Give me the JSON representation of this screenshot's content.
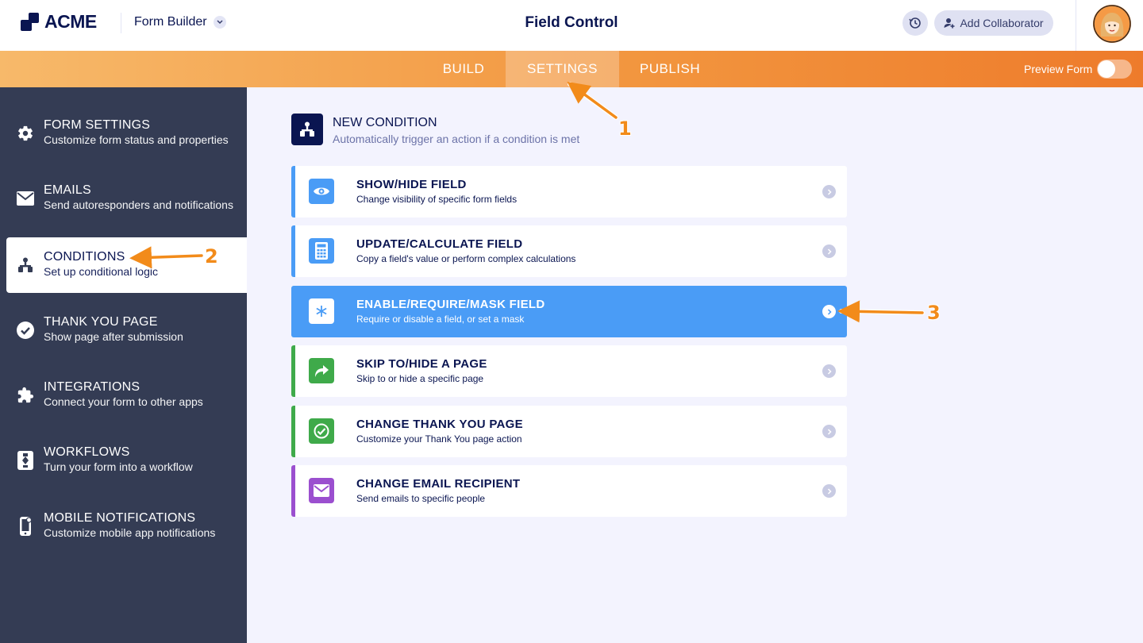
{
  "header": {
    "logo_text": "ACME",
    "builder_label": "Form Builder",
    "page_title": "Field Control",
    "collab_label": "Add Collaborator"
  },
  "nav": {
    "tabs": [
      {
        "label": "BUILD",
        "active": false
      },
      {
        "label": "SETTINGS",
        "active": true
      },
      {
        "label": "PUBLISH",
        "active": false
      }
    ],
    "preview_label": "Preview Form",
    "preview_on": false
  },
  "sidebar": {
    "items": [
      {
        "title": "FORM SETTINGS",
        "subtitle": "Customize form status and properties",
        "icon": "gear-icon"
      },
      {
        "title": "EMAILS",
        "subtitle": "Send autoresponders and notifications",
        "icon": "envelope-icon"
      },
      {
        "title": "CONDITIONS",
        "subtitle": "Set up conditional logic",
        "icon": "hierarchy-icon",
        "active": true
      },
      {
        "title": "THANK YOU PAGE",
        "subtitle": "Show page after submission",
        "icon": "check-circle-icon"
      },
      {
        "title": "INTEGRATIONS",
        "subtitle": "Connect your form to other apps",
        "icon": "puzzle-icon"
      },
      {
        "title": "WORKFLOWS",
        "subtitle": "Turn your form into a workflow",
        "icon": "workflow-icon"
      },
      {
        "title": "MOBILE NOTIFICATIONS",
        "subtitle": "Customize mobile app notifications",
        "icon": "mobile-icon"
      }
    ]
  },
  "new_condition": {
    "title": "NEW CONDITION",
    "subtitle": "Automatically trigger an action if a condition is met"
  },
  "conditions": [
    {
      "title": "SHOW/HIDE FIELD",
      "subtitle": "Change visibility of specific form fields",
      "icon": "eye-icon",
      "color": "#4a9cf6"
    },
    {
      "title": "UPDATE/CALCULATE FIELD",
      "subtitle": "Copy a field's value or perform complex calculations",
      "icon": "calculator-icon",
      "color": "#4a9cf6"
    },
    {
      "title": "ENABLE/REQUIRE/MASK FIELD",
      "subtitle": "Require or disable a field, or set a mask",
      "icon": "asterisk-icon",
      "color": "#4a9cf6",
      "active": true
    },
    {
      "title": "SKIP TO/HIDE A PAGE",
      "subtitle": "Skip to or hide a specific page",
      "icon": "redirect-arrow-icon",
      "color": "#3faa4a"
    },
    {
      "title": "CHANGE THANK YOU PAGE",
      "subtitle": "Customize your Thank You page action",
      "icon": "check-badge-icon",
      "color": "#3faa4a"
    },
    {
      "title": "CHANGE EMAIL RECIPIENT",
      "subtitle": "Send emails to specific people",
      "icon": "envelope-icon",
      "color": "#9b4fcf"
    }
  ],
  "annotations": [
    "1",
    "2",
    "3"
  ],
  "colors": {
    "navy": "#0a1551",
    "sidebar_bg": "#343c54",
    "accent_blue": "#4a9cf6",
    "accent_green": "#3faa4a",
    "accent_purple": "#9b4fcf",
    "annotation_orange": "#f28b1a"
  }
}
